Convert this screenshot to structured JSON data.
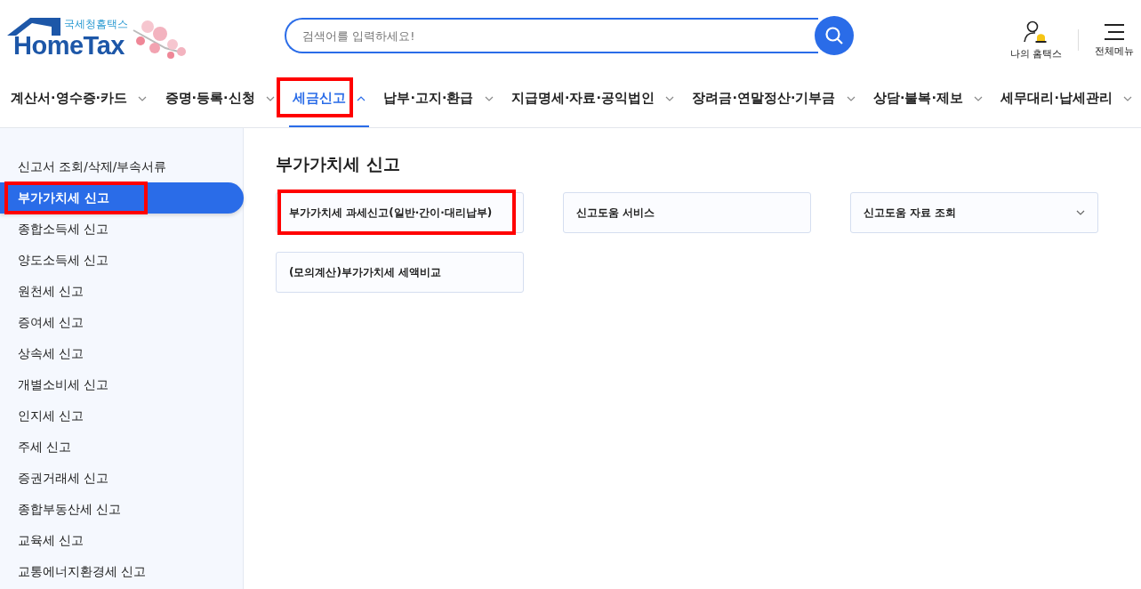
{
  "logo": {
    "subtitle": "국세청홈택스",
    "name": "HomeTax"
  },
  "search": {
    "placeholder": "검색어를 입력하세요!"
  },
  "utility": [
    {
      "kind": "my",
      "label": "나의 홈택스"
    },
    {
      "kind": "menu",
      "label": "전체메뉴"
    }
  ],
  "nav": [
    {
      "label": "계산서·영수증·카드",
      "selected": false,
      "highlighted": false
    },
    {
      "label": "증명·등록·신청",
      "selected": false,
      "highlighted": false
    },
    {
      "label": "세금신고",
      "selected": true,
      "highlighted": true
    },
    {
      "label": "납부·고지·환급",
      "selected": false,
      "highlighted": false
    },
    {
      "label": "지급명세·자료·공익법인",
      "selected": false,
      "highlighted": false
    },
    {
      "label": "장려금·연말정산·기부금",
      "selected": false,
      "highlighted": false
    },
    {
      "label": "상담·불복·제보",
      "selected": false,
      "highlighted": false
    },
    {
      "label": "세무대리·납세관리",
      "selected": false,
      "highlighted": false
    }
  ],
  "sidebar": {
    "items": [
      {
        "label": "신고서 조회/삭제/부속서류",
        "selected": false,
        "highlighted": false
      },
      {
        "label": "부가가치세 신고",
        "selected": true,
        "highlighted": true
      },
      {
        "label": "종합소득세 신고",
        "selected": false,
        "highlighted": false
      },
      {
        "label": "양도소득세 신고",
        "selected": false,
        "highlighted": false
      },
      {
        "label": "원천세 신고",
        "selected": false,
        "highlighted": false
      },
      {
        "label": "증여세 신고",
        "selected": false,
        "highlighted": false
      },
      {
        "label": "상속세 신고",
        "selected": false,
        "highlighted": false
      },
      {
        "label": "개별소비세 신고",
        "selected": false,
        "highlighted": false
      },
      {
        "label": "인지세 신고",
        "selected": false,
        "highlighted": false
      },
      {
        "label": "주세 신고",
        "selected": false,
        "highlighted": false
      },
      {
        "label": "증권거래세 신고",
        "selected": false,
        "highlighted": false
      },
      {
        "label": "종합부동산세 신고",
        "selected": false,
        "highlighted": false
      },
      {
        "label": "교육세 신고",
        "selected": false,
        "highlighted": false
      },
      {
        "label": "교통에너지환경세 신고",
        "selected": false,
        "highlighted": false
      }
    ]
  },
  "content": {
    "title": "부가가치세 신고",
    "cards": [
      {
        "label": "부가가치세 과세신고(일반·간이·대리납부)",
        "kind": "link",
        "highlighted": true
      },
      {
        "label": "신고도움 서비스",
        "kind": "link",
        "highlighted": false
      },
      {
        "label": "신고도움 자료 조회",
        "kind": "dropdown",
        "highlighted": false
      },
      {
        "label": "(모의계산)부가가치세 세액비교",
        "kind": "link",
        "highlighted": false
      }
    ]
  }
}
